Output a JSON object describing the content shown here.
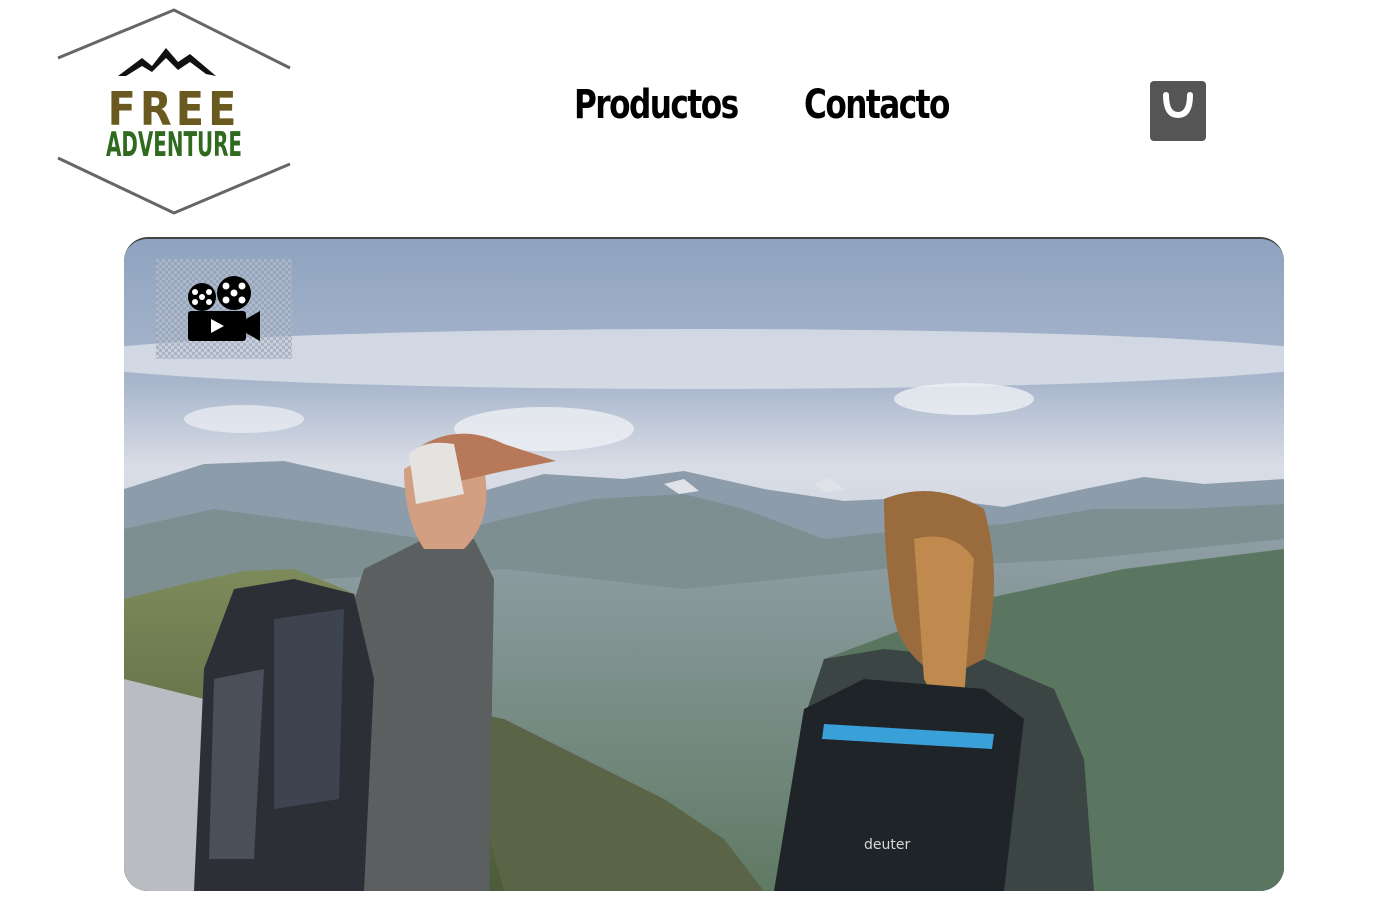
{
  "brand": {
    "logo_line1": "FREE",
    "logo_line2": "ADVENTURE",
    "color_dark_brown": "#6b5a1f",
    "color_green": "#2f6a1f"
  },
  "nav": {
    "products_label": "Productos",
    "contact_label": "Contacto"
  },
  "cart": {
    "icon": "shopping-bag-icon",
    "color": "#555555"
  },
  "hero": {
    "video_icon": "film-camera-icon",
    "backpack_brand": "deuter"
  }
}
